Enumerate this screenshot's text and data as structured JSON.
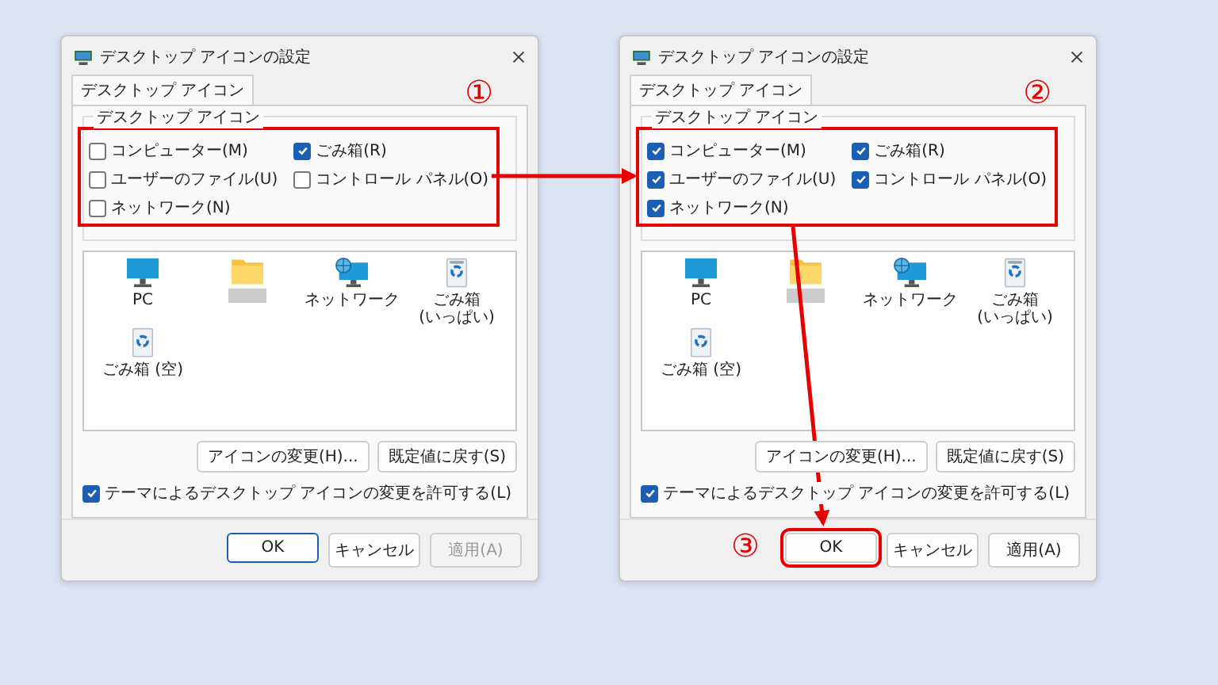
{
  "dialogs": [
    {
      "title": "デスクトップ アイコンの設定",
      "tabs": [
        {
          "label": "デスクトップ アイコン",
          "selected": true
        }
      ],
      "group_label": "デスクトップ アイコン",
      "checkboxes_highlighted": true,
      "checkboxes_marker": "①",
      "checkboxes": [
        {
          "label": "コンピューター(M)",
          "checked": false
        },
        {
          "label": "ごみ箱(R)",
          "checked": true
        },
        {
          "label": "ユーザーのファイル(U)",
          "checked": false
        },
        {
          "label": "コントロール パネル(O)",
          "checked": false
        },
        {
          "label": "ネットワーク(N)",
          "checked": false
        }
      ],
      "icons": [
        {
          "kind": "monitor",
          "label": "PC"
        },
        {
          "kind": "folder",
          "redacted": true
        },
        {
          "kind": "network",
          "label": "ネットワーク"
        },
        {
          "kind": "recycle-full",
          "label": "ごみ箱 (いっぱい)"
        },
        {
          "kind": "recycle-empty",
          "label": "ごみ箱 (空)"
        }
      ],
      "action_buttons": [
        "アイコンの変更(H)...",
        "既定値に戻す(S)"
      ],
      "theme_option": {
        "label": "テーマによるデスクトップ アイコンの変更を許可する(L)",
        "checked": true
      },
      "footer_buttons": [
        {
          "label": "OK",
          "default": true,
          "disabled": false,
          "highlighted": false
        },
        {
          "label": "キャンセル",
          "default": false,
          "disabled": false,
          "highlighted": false
        },
        {
          "label": "適用(A)",
          "default": false,
          "disabled": true,
          "highlighted": false
        }
      ]
    },
    {
      "title": "デスクトップ アイコンの設定",
      "tabs": [
        {
          "label": "デスクトップ アイコン",
          "selected": true
        }
      ],
      "group_label": "デスクトップ アイコン",
      "checkboxes_highlighted": true,
      "checkboxes_marker": "②",
      "checkboxes": [
        {
          "label": "コンピューター(M)",
          "checked": true
        },
        {
          "label": "ごみ箱(R)",
          "checked": true
        },
        {
          "label": "ユーザーのファイル(U)",
          "checked": true
        },
        {
          "label": "コントロール パネル(O)",
          "checked": true
        },
        {
          "label": "ネットワーク(N)",
          "checked": true
        }
      ],
      "icons": [
        {
          "kind": "monitor",
          "label": "PC"
        },
        {
          "kind": "folder",
          "redacted": true
        },
        {
          "kind": "network",
          "label": "ネットワーク"
        },
        {
          "kind": "recycle-full",
          "label": "ごみ箱 (いっぱい)"
        },
        {
          "kind": "recycle-empty",
          "label": "ごみ箱 (空)"
        }
      ],
      "action_buttons": [
        "アイコンの変更(H)...",
        "既定値に戻す(S)"
      ],
      "theme_option": {
        "label": "テーマによるデスクトップ アイコンの変更を許可する(L)",
        "checked": true
      },
      "footer_buttons": [
        {
          "label": "OK",
          "default": false,
          "disabled": false,
          "highlighted": true,
          "marker": "③"
        },
        {
          "label": "キャンセル",
          "default": false,
          "disabled": false,
          "highlighted": false
        },
        {
          "label": "適用(A)",
          "default": false,
          "disabled": false,
          "highlighted": false
        }
      ]
    }
  ]
}
